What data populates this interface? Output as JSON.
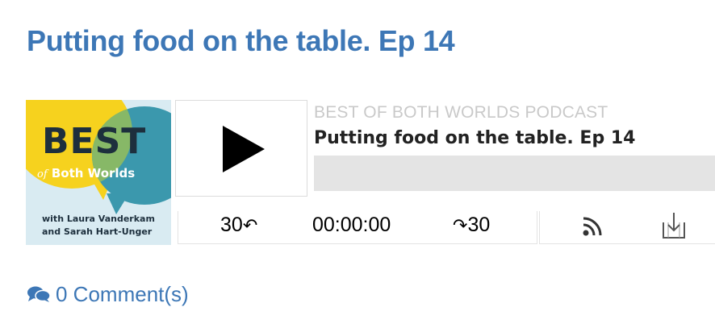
{
  "post": {
    "title": "Putting food on the table. Ep 14"
  },
  "cover": {
    "best": "BEST",
    "of": "of",
    "both_worlds": "Both Worlds",
    "hosts_line1": "with Laura Vanderkam",
    "hosts_line2": "and Sarah Hart-Unger"
  },
  "player": {
    "podcast_name": "BEST OF BOTH WORLDS PODCAST",
    "episode_title": "Putting food on the table. Ep 14",
    "progress": 0,
    "skip_back_label": "30",
    "skip_back_arrow": "↶",
    "current_time": "00:00:00",
    "skip_forward_arrow": "↷",
    "skip_forward_label": "30",
    "icons": {
      "play": "play-icon",
      "rss": "rss-icon",
      "download": "download-icon"
    }
  },
  "comments": {
    "label": "0 Comment(s)",
    "icon": "comments-icon"
  },
  "colors": {
    "link": "#3d77b6",
    "progress_track": "#e4e4e4",
    "podcast_name": "#c9c9c9"
  }
}
